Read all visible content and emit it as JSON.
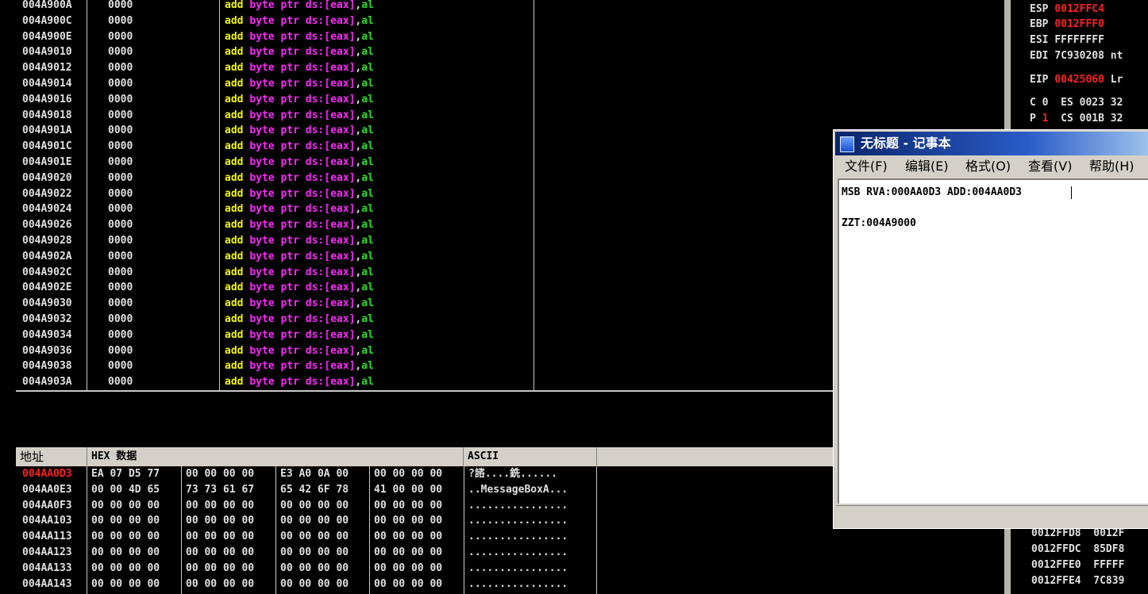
{
  "disasm": {
    "rows": [
      {
        "addr": "004A900A",
        "hex": "0000",
        "mnem": "add",
        "size": "byte",
        "ptr": "ptr",
        "seg": "ds:[eax]",
        "reg": "al"
      },
      {
        "addr": "004A900C",
        "hex": "0000",
        "mnem": "add",
        "size": "byte",
        "ptr": "ptr",
        "seg": "ds:[eax]",
        "reg": "al"
      },
      {
        "addr": "004A900E",
        "hex": "0000",
        "mnem": "add",
        "size": "byte",
        "ptr": "ptr",
        "seg": "ds:[eax]",
        "reg": "al"
      },
      {
        "addr": "004A9010",
        "hex": "0000",
        "mnem": "add",
        "size": "byte",
        "ptr": "ptr",
        "seg": "ds:[eax]",
        "reg": "al"
      },
      {
        "addr": "004A9012",
        "hex": "0000",
        "mnem": "add",
        "size": "byte",
        "ptr": "ptr",
        "seg": "ds:[eax]",
        "reg": "al"
      },
      {
        "addr": "004A9014",
        "hex": "0000",
        "mnem": "add",
        "size": "byte",
        "ptr": "ptr",
        "seg": "ds:[eax]",
        "reg": "al"
      },
      {
        "addr": "004A9016",
        "hex": "0000",
        "mnem": "add",
        "size": "byte",
        "ptr": "ptr",
        "seg": "ds:[eax]",
        "reg": "al"
      },
      {
        "addr": "004A9018",
        "hex": "0000",
        "mnem": "add",
        "size": "byte",
        "ptr": "ptr",
        "seg": "ds:[eax]",
        "reg": "al"
      },
      {
        "addr": "004A901A",
        "hex": "0000",
        "mnem": "add",
        "size": "byte",
        "ptr": "ptr",
        "seg": "ds:[eax]",
        "reg": "al"
      },
      {
        "addr": "004A901C",
        "hex": "0000",
        "mnem": "add",
        "size": "byte",
        "ptr": "ptr",
        "seg": "ds:[eax]",
        "reg": "al"
      },
      {
        "addr": "004A901E",
        "hex": "0000",
        "mnem": "add",
        "size": "byte",
        "ptr": "ptr",
        "seg": "ds:[eax]",
        "reg": "al"
      },
      {
        "addr": "004A9020",
        "hex": "0000",
        "mnem": "add",
        "size": "byte",
        "ptr": "ptr",
        "seg": "ds:[eax]",
        "reg": "al"
      },
      {
        "addr": "004A9022",
        "hex": "0000",
        "mnem": "add",
        "size": "byte",
        "ptr": "ptr",
        "seg": "ds:[eax]",
        "reg": "al"
      },
      {
        "addr": "004A9024",
        "hex": "0000",
        "mnem": "add",
        "size": "byte",
        "ptr": "ptr",
        "seg": "ds:[eax]",
        "reg": "al"
      },
      {
        "addr": "004A9026",
        "hex": "0000",
        "mnem": "add",
        "size": "byte",
        "ptr": "ptr",
        "seg": "ds:[eax]",
        "reg": "al"
      },
      {
        "addr": "004A9028",
        "hex": "0000",
        "mnem": "add",
        "size": "byte",
        "ptr": "ptr",
        "seg": "ds:[eax]",
        "reg": "al"
      },
      {
        "addr": "004A902A",
        "hex": "0000",
        "mnem": "add",
        "size": "byte",
        "ptr": "ptr",
        "seg": "ds:[eax]",
        "reg": "al"
      },
      {
        "addr": "004A902C",
        "hex": "0000",
        "mnem": "add",
        "size": "byte",
        "ptr": "ptr",
        "seg": "ds:[eax]",
        "reg": "al"
      },
      {
        "addr": "004A902E",
        "hex": "0000",
        "mnem": "add",
        "size": "byte",
        "ptr": "ptr",
        "seg": "ds:[eax]",
        "reg": "al"
      },
      {
        "addr": "004A9030",
        "hex": "0000",
        "mnem": "add",
        "size": "byte",
        "ptr": "ptr",
        "seg": "ds:[eax]",
        "reg": "al"
      },
      {
        "addr": "004A9032",
        "hex": "0000",
        "mnem": "add",
        "size": "byte",
        "ptr": "ptr",
        "seg": "ds:[eax]",
        "reg": "al"
      },
      {
        "addr": "004A9034",
        "hex": "0000",
        "mnem": "add",
        "size": "byte",
        "ptr": "ptr",
        "seg": "ds:[eax]",
        "reg": "al"
      },
      {
        "addr": "004A9036",
        "hex": "0000",
        "mnem": "add",
        "size": "byte",
        "ptr": "ptr",
        "seg": "ds:[eax]",
        "reg": "al"
      },
      {
        "addr": "004A9038",
        "hex": "0000",
        "mnem": "add",
        "size": "byte",
        "ptr": "ptr",
        "seg": "ds:[eax]",
        "reg": "al"
      },
      {
        "addr": "004A903A",
        "hex": "0000",
        "mnem": "add",
        "size": "byte",
        "ptr": "ptr",
        "seg": "ds:[eax]",
        "reg": "al"
      }
    ]
  },
  "dump": {
    "headers": {
      "addr": "地址",
      "hex": "HEX 数据",
      "ascii": "ASCII"
    },
    "rows": [
      {
        "addr": "004AA0D3",
        "selected": true,
        "groups": [
          "EA 07 D5 77",
          "00 00 00 00",
          "E3 A0 0A 00",
          "00 00 00 00"
        ],
        "ascii": "?諮....銑......"
      },
      {
        "addr": "004AA0E3",
        "selected": false,
        "groups": [
          "00 00 4D 65",
          "73 73 61 67",
          "65 42 6F 78",
          "41 00 00 00"
        ],
        "ascii": "..MessageBoxA..."
      },
      {
        "addr": "004AA0F3",
        "selected": false,
        "groups": [
          "00 00 00 00",
          "00 00 00 00",
          "00 00 00 00",
          "00 00 00 00"
        ],
        "ascii": "................"
      },
      {
        "addr": "004AA103",
        "selected": false,
        "groups": [
          "00 00 00 00",
          "00 00 00 00",
          "00 00 00 00",
          "00 00 00 00"
        ],
        "ascii": "................"
      },
      {
        "addr": "004AA113",
        "selected": false,
        "groups": [
          "00 00 00 00",
          "00 00 00 00",
          "00 00 00 00",
          "00 00 00 00"
        ],
        "ascii": "................"
      },
      {
        "addr": "004AA123",
        "selected": false,
        "groups": [
          "00 00 00 00",
          "00 00 00 00",
          "00 00 00 00",
          "00 00 00 00"
        ],
        "ascii": "................"
      },
      {
        "addr": "004AA133",
        "selected": false,
        "groups": [
          "00 00 00 00",
          "00 00 00 00",
          "00 00 00 00",
          "00 00 00 00"
        ],
        "ascii": "................"
      },
      {
        "addr": "004AA143",
        "selected": false,
        "groups": [
          "00 00 00 00",
          "00 00 00 00",
          "00 00 00 00",
          "00 00 00 00"
        ],
        "ascii": "................"
      }
    ]
  },
  "registers": {
    "list": [
      {
        "name": "ESP",
        "value": "0012FFC4",
        "red": true,
        "extra": ""
      },
      {
        "name": "EBP",
        "value": "0012FFF0",
        "red": true,
        "extra": ""
      },
      {
        "name": "ESI",
        "value": "FFFFFFFF",
        "red": false,
        "extra": ""
      },
      {
        "name": "EDI",
        "value": "7C930208",
        "red": false,
        "extra": "nt"
      },
      {
        "name": "EIP",
        "value": "00425060",
        "red": true,
        "extra": "Lr"
      }
    ],
    "flags": [
      {
        "flag": "C",
        "flag_val": "0",
        "flag_red": false,
        "seg": "ES",
        "seg_val": "0023",
        "seg_extra": "32"
      },
      {
        "flag": "P",
        "flag_val": "1",
        "flag_red": true,
        "seg": "CS",
        "seg_val": "001B",
        "seg_extra": "32"
      }
    ]
  },
  "stack": {
    "rows": [
      {
        "addr": "0012FFD8",
        "value": "0012F"
      },
      {
        "addr": "0012FFDC",
        "value": "85DF8"
      },
      {
        "addr": "0012FFE0",
        "value": "FFFFF"
      },
      {
        "addr": "0012FFE4",
        "value": "7C839"
      }
    ]
  },
  "notepad": {
    "title": "无标题 - 记事本",
    "menu": [
      "文件(F)",
      "编辑(E)",
      "格式(O)",
      "查看(V)",
      "帮助(H)"
    ],
    "lines": [
      "MSB RVA:000AA0D3 ADD:004AA0D3",
      "",
      "ZZT:004A9000"
    ]
  },
  "colors": {
    "red": "#ff2020",
    "yellow": "#f5f500",
    "magenta": "#ff28ff",
    "green": "#28e028"
  }
}
